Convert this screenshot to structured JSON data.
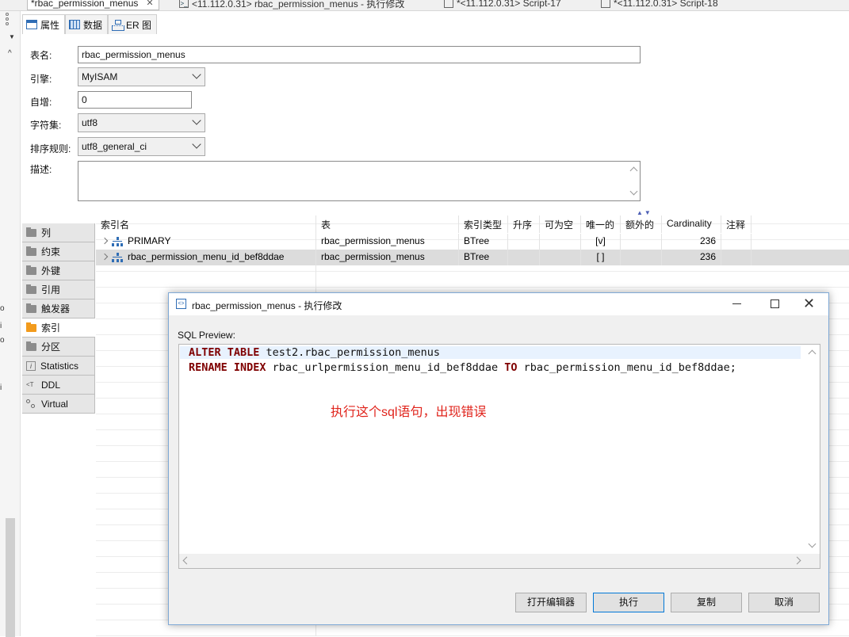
{
  "top_tabs": [
    {
      "label": "*rbac_permission_menus",
      "active": true
    },
    {
      "label": "<11.112.0.31> rbac_permission_menus - 执行修改"
    },
    {
      "label": "*<11.112.0.31> Script-17"
    },
    {
      "label": "*<11.112.0.31> Script-18"
    }
  ],
  "sub_tabs": [
    "属性",
    "数据",
    "ER 图"
  ],
  "form": {
    "table_name_label": "表名:",
    "table_name_value": "rbac_permission_menus",
    "engine_label": "引擎:",
    "engine_value": "MyISAM",
    "auto_inc_label": "自增:",
    "auto_inc_value": "0",
    "charset_label": "字符集:",
    "charset_value": "utf8",
    "collation_label": "排序规则:",
    "collation_value": "utf8_general_ci",
    "desc_label": "描述:",
    "desc_value": ""
  },
  "nav": [
    {
      "label": "列",
      "icon": "folder-icon"
    },
    {
      "label": "约束",
      "icon": "constraint-icon"
    },
    {
      "label": "外键",
      "icon": "folder-icon"
    },
    {
      "label": "引用",
      "icon": "folder-icon"
    },
    {
      "label": "触发器",
      "icon": "folder-icon"
    },
    {
      "label": "索引",
      "icon": "folder-icon",
      "active": true
    },
    {
      "label": "分区",
      "icon": "folder-icon"
    },
    {
      "label": "Statistics",
      "icon": "info-icon"
    },
    {
      "label": "DDL",
      "icon": "ddl-icon"
    },
    {
      "label": "Virtual",
      "icon": "virtual-icon"
    }
  ],
  "grid": {
    "columns": [
      "索引名",
      "表",
      "索引类型",
      "升序",
      "可为空",
      "唯一的",
      "额外的",
      "Cardinality",
      "注释"
    ],
    "rows": [
      {
        "name": "PRIMARY",
        "table": "rbac_permission_menus",
        "type": "BTree",
        "asc": "",
        "nullable": "",
        "unique": "[v]",
        "extra": "",
        "cardinality": "236",
        "comment": ""
      },
      {
        "name": "rbac_permission_menu_id_bef8ddae",
        "table": "rbac_permission_menus",
        "type": "BTree",
        "asc": "",
        "nullable": "",
        "unique": "[ ]",
        "extra": "",
        "cardinality": "236",
        "comment": ""
      }
    ]
  },
  "dialog": {
    "title": "rbac_permission_menus - 执行修改",
    "sql_label": "SQL Preview:",
    "line1": {
      "kw1": "ALTER TABLE",
      "rest": " test2.rbac_permission_menus"
    },
    "line2": {
      "kw1": "RENAME INDEX",
      "mid": " rbac_urlpermission_menu_id_bef8ddae ",
      "kw2": "TO",
      "rest": " rbac_permission_menu_id_bef8ddae;"
    },
    "annotation": "执行这个sql语句，出现错误",
    "buttons": {
      "open_editor": "打开编辑器",
      "execute": "执行",
      "copy": "复制",
      "cancel": "取消"
    }
  },
  "colors": {
    "keyword": "#7f0000",
    "annotation": "#e0231b",
    "accent": "#0078d7",
    "folder_active": "#f29b1d"
  }
}
